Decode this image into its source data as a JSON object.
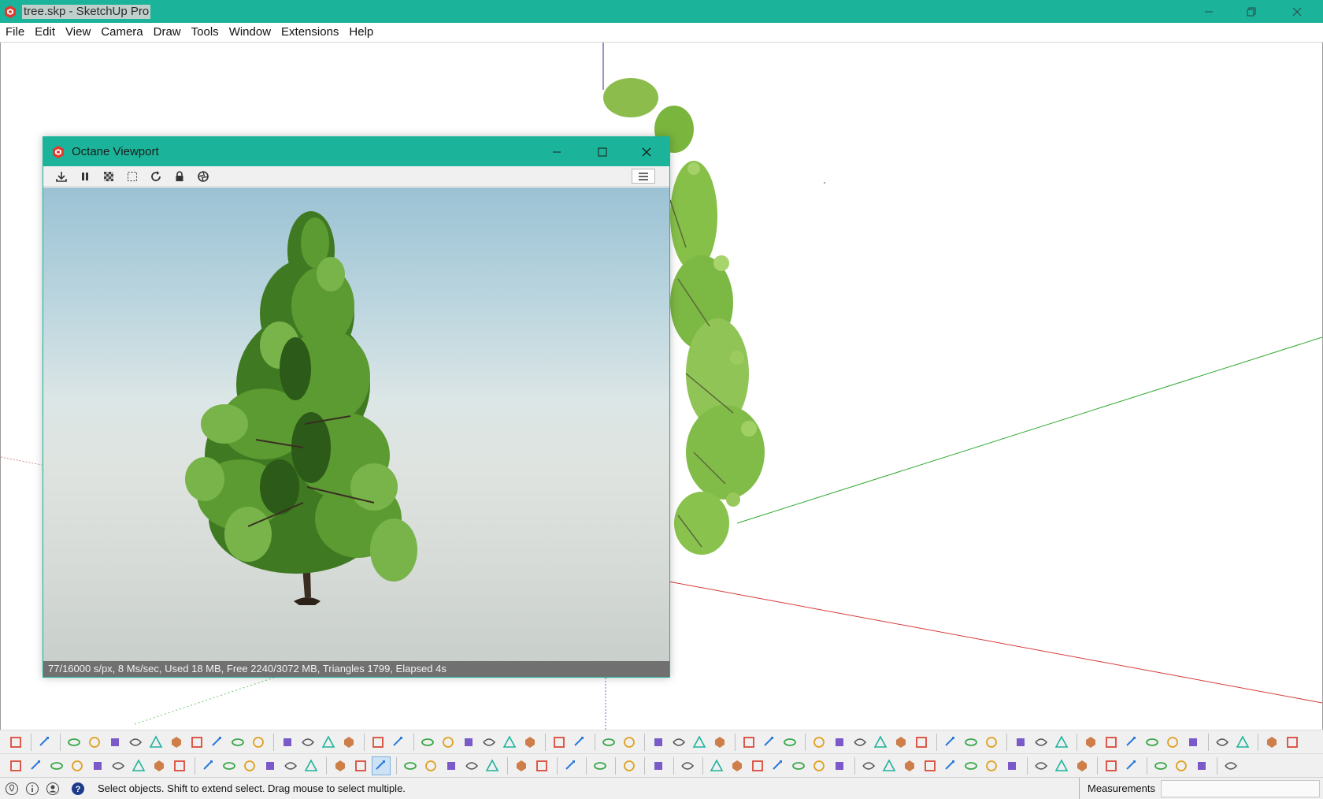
{
  "window": {
    "title": "tree.skp - SketchUp Pro",
    "accent": "#1bb39a"
  },
  "menu": {
    "items": [
      "File",
      "Edit",
      "View",
      "Camera",
      "Draw",
      "Tools",
      "Window",
      "Extensions",
      "Help"
    ]
  },
  "octane": {
    "title": "Octane Viewport",
    "status": "77/16000 s/px, 8 Ms/sec, Used 18 MB, Free 2240/3072 MB, Triangles 1799, Elapsed 4s",
    "tools": [
      "save-render-icon",
      "pause-icon",
      "checkerboard-icon",
      "region-select-icon",
      "refresh-icon",
      "lock-icon",
      "aperture-icon"
    ]
  },
  "axes": {
    "red": "#d63a3a",
    "green": "#2fa82f",
    "blue": "#2a2aa0"
  },
  "toolbar": {
    "row1": [
      "select-icon",
      "eraser-icon",
      "pencil-icon",
      "rectangle-icon",
      "circle-icon",
      "polygon-icon",
      "ellipse-icon",
      "parallelogram-icon",
      "arc-icon",
      "pie-icon",
      "freehand-icon",
      "offset-icon",
      "push-pull-icon",
      "move-icon",
      "paint-bucket-icon",
      "tape-measure-icon",
      "tree-icon",
      "leaf-icon",
      "color-cube-icon",
      "blue-axis-icon",
      "flip-up-icon",
      "flip-down-icon",
      "scale-icon",
      "mirror-icon",
      "undo-icon",
      "redo-icon",
      "tag-icon",
      "book-icon",
      "sheet-icon",
      "figure-icon",
      "globe-icon",
      "box-icon",
      "box-open-icon",
      "box-closed-icon",
      "iso-view-icon",
      "top-view-icon",
      "front-view-icon",
      "right-view-icon",
      "back-view-icon",
      "left-view-icon",
      "section-plane-icon",
      "section-fill-icon",
      "section-cut-icon",
      "dimension-icon",
      "text-icon",
      "axes-icon",
      "protractor-icon",
      "wireframe-icon",
      "hidden-line-icon",
      "shaded-icon",
      "textured-icon",
      "monochrome-icon",
      "xray-icon",
      "edges-icon",
      "sun-icon",
      "sphere-icon",
      "arrow-icon"
    ],
    "row2": [
      "orbit-icon",
      "pan-icon",
      "zoom-icon",
      "zoom-window-icon",
      "zoom-extents-icon",
      "zoom-previous-icon",
      "walk-icon",
      "look-around-icon",
      "footprints-icon",
      "house-1-icon",
      "house-2-icon",
      "house-3-icon",
      "house-4-icon",
      "house-5-icon",
      "house-6-icon",
      "orbit-cursor-icon",
      "iso-cube-icon",
      "iso-cube-active-icon",
      "dimension-tool-icon",
      "protractor-tool-icon",
      "axes-tool-icon",
      "text-tool-icon",
      "3d-text-icon",
      "camera-icon",
      "layout-icon",
      "shield-icon",
      "clock-icon",
      "wrench-icon",
      "paint-icon",
      "lightbulb-icon",
      "plant-1-icon",
      "plant-2-icon",
      "plant-3-icon",
      "bush-icon",
      "grass-icon",
      "shrub-icon",
      "small-tree-icon",
      "eraser-2-icon",
      "ruler-icon",
      "material-1-icon",
      "material-2-icon",
      "material-3-icon",
      "material-4-icon",
      "material-5-icon",
      "texture-icon",
      "red-cube-icon",
      "blue-cube-icon",
      "gray-cube-icon",
      "fan-icon",
      "lens-icon",
      "folder-icon",
      "folder-export-icon",
      "folder-import-icon",
      "panel-icon"
    ]
  },
  "statusbar": {
    "message": "Select objects. Shift to extend select. Drag mouse to select multiple.",
    "measurements_label": "Measurements",
    "measurements_value": ""
  }
}
